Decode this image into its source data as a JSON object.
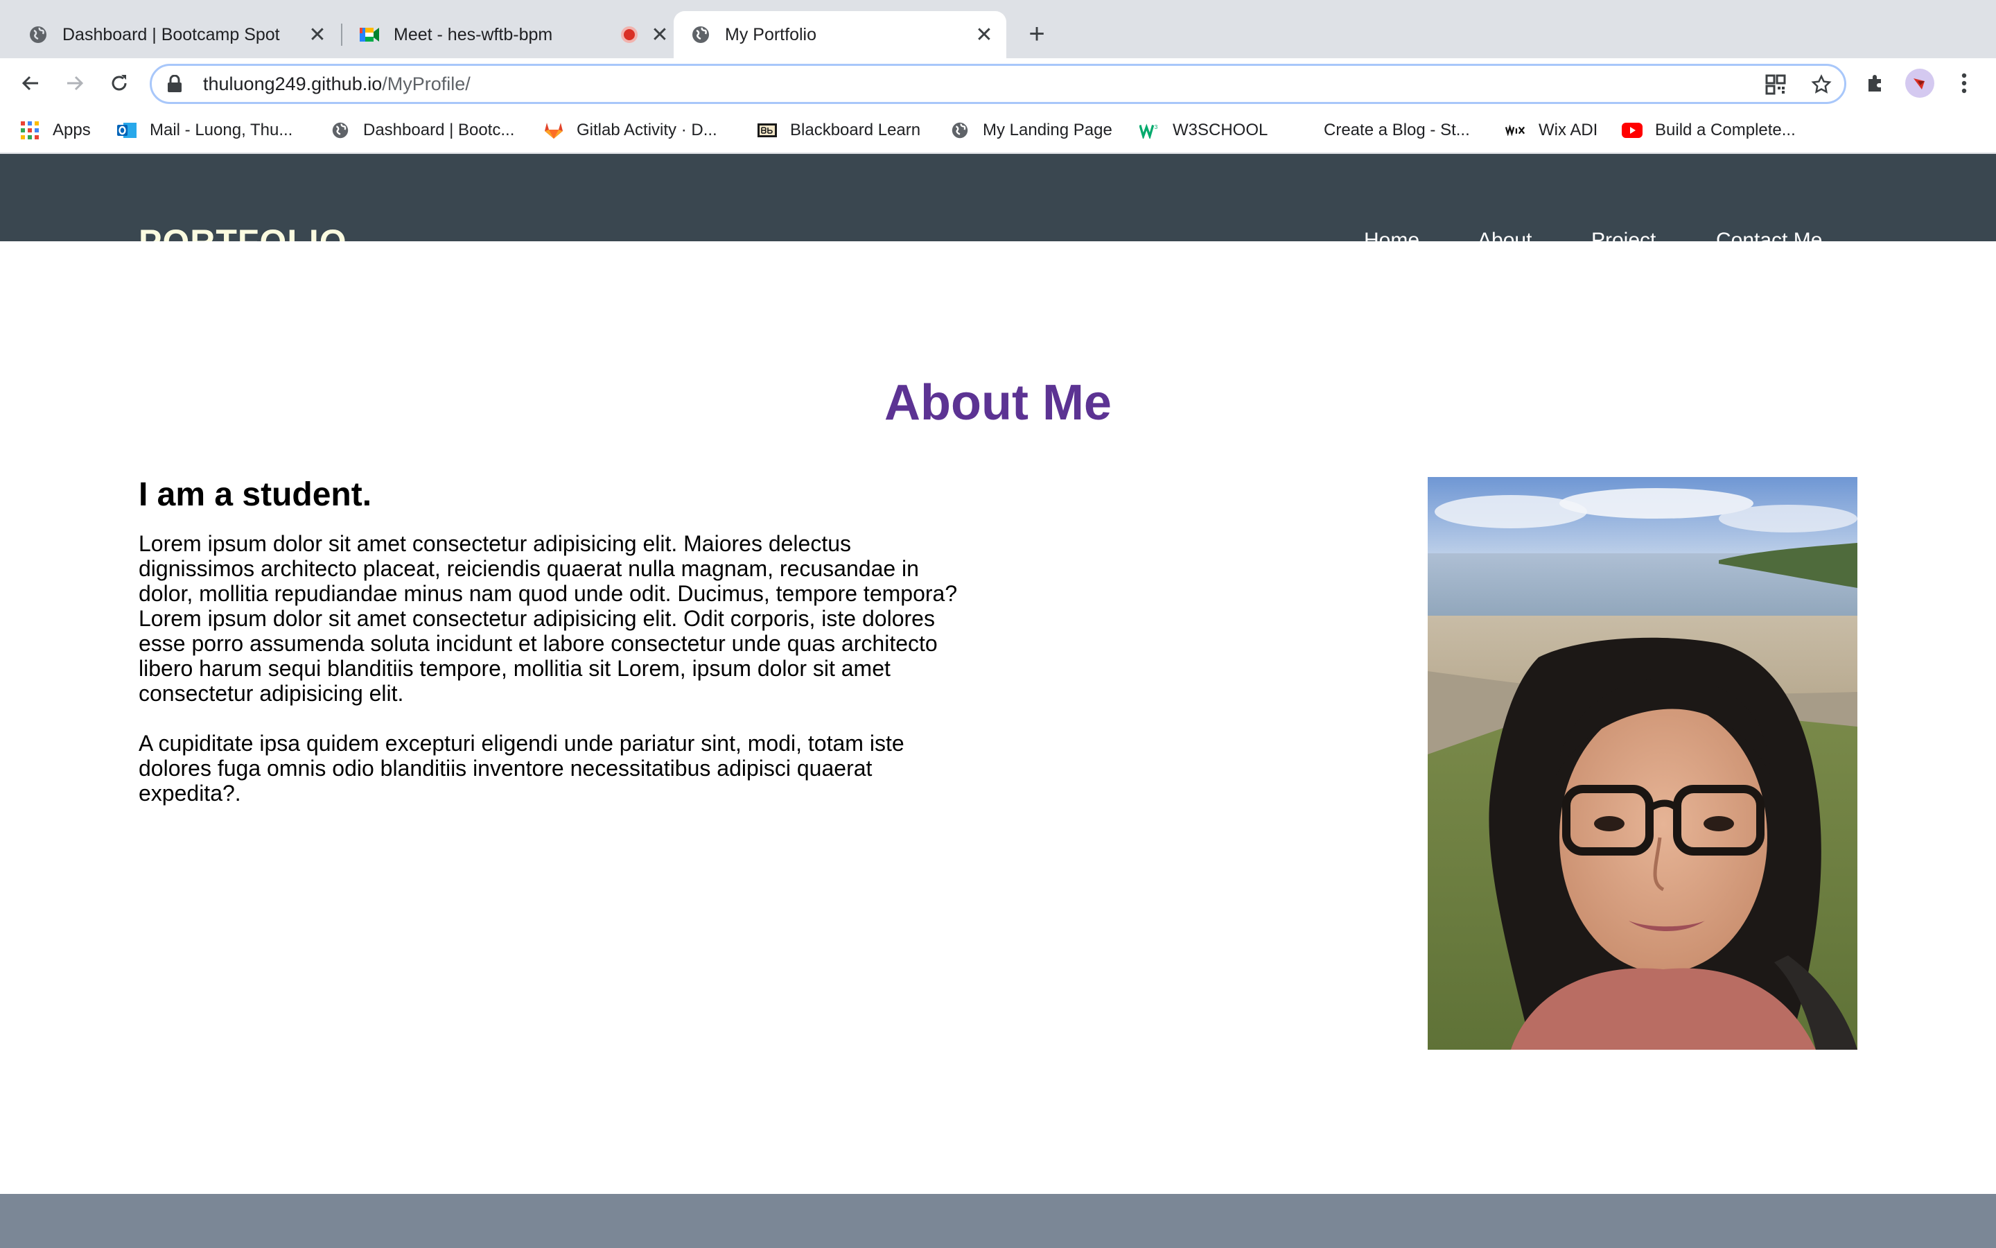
{
  "browser": {
    "tabs": [
      {
        "title": "Dashboard | Bootcamp Spot",
        "icon": "globe-icon",
        "active": false
      },
      {
        "title": "Meet - hes-wftb-bpm",
        "icon": "google-meet-icon",
        "active": false,
        "recording": true
      },
      {
        "title": "My Portfolio",
        "icon": "globe-icon",
        "active": true
      }
    ],
    "new_tab_label": "+",
    "close_glyph": "✕",
    "url_host": "thuluong249.github.io",
    "url_path": "/MyProfile/",
    "bookmarks": [
      {
        "label": "Apps",
        "icon": "apps-grid-icon"
      },
      {
        "label": "Mail - Luong, Thu...",
        "icon": "outlook-icon"
      },
      {
        "label": "Dashboard | Bootc...",
        "icon": "globe-icon"
      },
      {
        "label": "Gitlab Activity · D...",
        "icon": "gitlab-icon"
      },
      {
        "label": "Blackboard Learn",
        "icon": "blackboard-icon"
      },
      {
        "label": "My Landing Page",
        "icon": "globe-icon"
      },
      {
        "label": "W3SCHOOL",
        "icon": "w3schools-icon"
      },
      {
        "label": "Create a Blog - St...",
        "icon": "blank-icon"
      },
      {
        "label": "Wix ADI",
        "icon": "wix-icon"
      },
      {
        "label": "Build a Complete...",
        "icon": "youtube-icon"
      }
    ]
  },
  "site": {
    "brand": "PORTFOLIO",
    "nav": [
      "Home",
      "About",
      "Project",
      "Contact Me"
    ],
    "about_title": "About Me",
    "student_heading": "I am a student.",
    "paragraph_1": "Lorem ipsum dolor sit amet consectetur adipisicing elit. Maiores delectus dignissimos architecto placeat, reiciendis quaerat nulla magnam, recusandae in dolor, mollitia repudiandae minus nam quod unde odit. Ducimus, tempore tempora?Lorem ipsum dolor sit amet consectetur adipisicing elit. Odit corporis, iste dolores esse porro assumenda soluta incidunt et labore consectetur unde quas architecto libero harum sequi blanditiis tempore, mollitia sit Lorem, ipsum dolor sit amet consectetur adipisicing elit.",
    "paragraph_2": "A cupiditate ipsa quidem excepturi eligendi unde pariatur sint, modi, totam iste dolores fuga omnis odio blanditiis inventore necessitatibus adipisci quaerat expedita?."
  },
  "colors": {
    "header_bg": "#3a4750",
    "brand": "#fbfbe0",
    "title": "#5c3393",
    "footer_bg": "#7b8796"
  }
}
